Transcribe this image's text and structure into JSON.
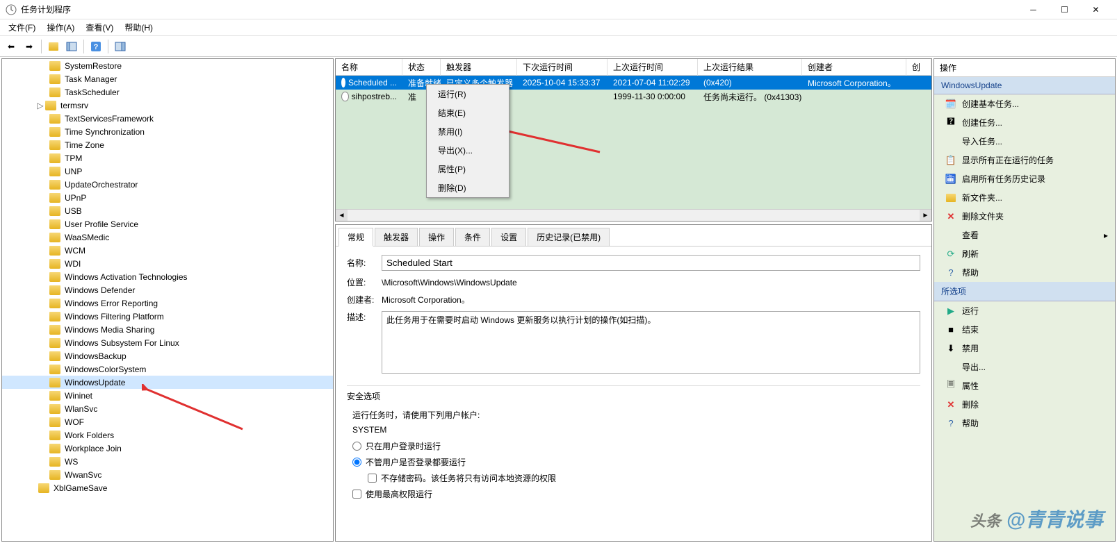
{
  "window": {
    "title": "任务计划程序"
  },
  "menubar": {
    "file": "文件(F)",
    "action": "操作(A)",
    "view": "查看(V)",
    "help": "帮助(H)"
  },
  "tree": {
    "items": [
      "SystemRestore",
      "Task Manager",
      "TaskScheduler",
      "termsrv",
      "TextServicesFramework",
      "Time Synchronization",
      "Time Zone",
      "TPM",
      "UNP",
      "UpdateOrchestrator",
      "UPnP",
      "USB",
      "User Profile Service",
      "WaaSMedic",
      "WCM",
      "WDI",
      "Windows Activation Technologies",
      "Windows Defender",
      "Windows Error Reporting",
      "Windows Filtering Platform",
      "Windows Media Sharing",
      "Windows Subsystem For Linux",
      "WindowsBackup",
      "WindowsColorSystem",
      "WindowsUpdate",
      "Wininet",
      "WlanSvc",
      "WOF",
      "Work Folders",
      "Workplace Join",
      "WS",
      "WwanSvc"
    ],
    "parent": "XblGameSave",
    "selected": "WindowsUpdate",
    "expandable": "termsrv"
  },
  "tasklist": {
    "columns": {
      "name": "名称",
      "status": "状态",
      "triggers": "触发器",
      "nextRun": "下次运行时间",
      "lastRun": "上次运行时间",
      "lastResult": "上次运行结果",
      "creator": "创建者",
      "created": "创"
    },
    "rows": [
      {
        "name": "Scheduled ...",
        "status": "准备就绪",
        "triggers": "已定义多个触发器",
        "nextRun": "2025-10-04 15:33:37",
        "lastRun": "2021-07-04 11:02:29",
        "lastResult": "(0x420)",
        "creator": "Microsoft Corporation。"
      },
      {
        "name": "sihpostreb...",
        "status": "准",
        "triggers": "",
        "nextRun": "",
        "lastRun": "1999-11-30 0:00:00",
        "lastResult": "任务尚未运行。 (0x41303)",
        "creator": ""
      }
    ]
  },
  "contextMenu": {
    "run": "运行(R)",
    "end": "结束(E)",
    "disable": "禁用(I)",
    "export": "导出(X)...",
    "properties": "属性(P)",
    "delete": "删除(D)"
  },
  "detail": {
    "tabs": {
      "general": "常规",
      "triggers": "触发器",
      "actions": "操作",
      "conditions": "条件",
      "settings": "设置",
      "history": "历史记录(已禁用)"
    },
    "labels": {
      "name": "名称:",
      "location": "位置:",
      "creator": "创建者:",
      "desc": "描述:"
    },
    "values": {
      "name": "Scheduled Start",
      "location": "\\Microsoft\\Windows\\WindowsUpdate",
      "creator": "Microsoft Corporation。",
      "desc": "此任务用于在需要时启动 Windows 更新服务以执行计划的操作(如扫描)。"
    },
    "security": {
      "title": "安全选项",
      "runAsLabel": "运行任务时，请使用下列用户帐户:",
      "account": "SYSTEM",
      "onlyLogged": "只在用户登录时运行",
      "notLogged": "不管用户是否登录都要运行",
      "noStore": "不存储密码。该任务将只有访问本地资源的权限",
      "highest": "使用最高权限运行"
    }
  },
  "actions": {
    "header": "操作",
    "group1": "WindowsUpdate",
    "items1": {
      "createBasic": "创建基本任务...",
      "create": "创建任务...",
      "import": "导入任务...",
      "showRunning": "显示所有正在运行的任务",
      "enableHistory": "启用所有任务历史记录",
      "newFolder": "新文件夹...",
      "deleteFolder": "删除文件夹",
      "view": "查看",
      "refresh": "刷新",
      "help": "帮助"
    },
    "group2": "所选项",
    "items2": {
      "run": "运行",
      "end": "结束",
      "disable": "禁用",
      "export": "导出...",
      "properties": "属性",
      "delete": "删除",
      "help": "帮助"
    }
  },
  "watermark": {
    "pre": "头条",
    "main": "@青青说事"
  }
}
